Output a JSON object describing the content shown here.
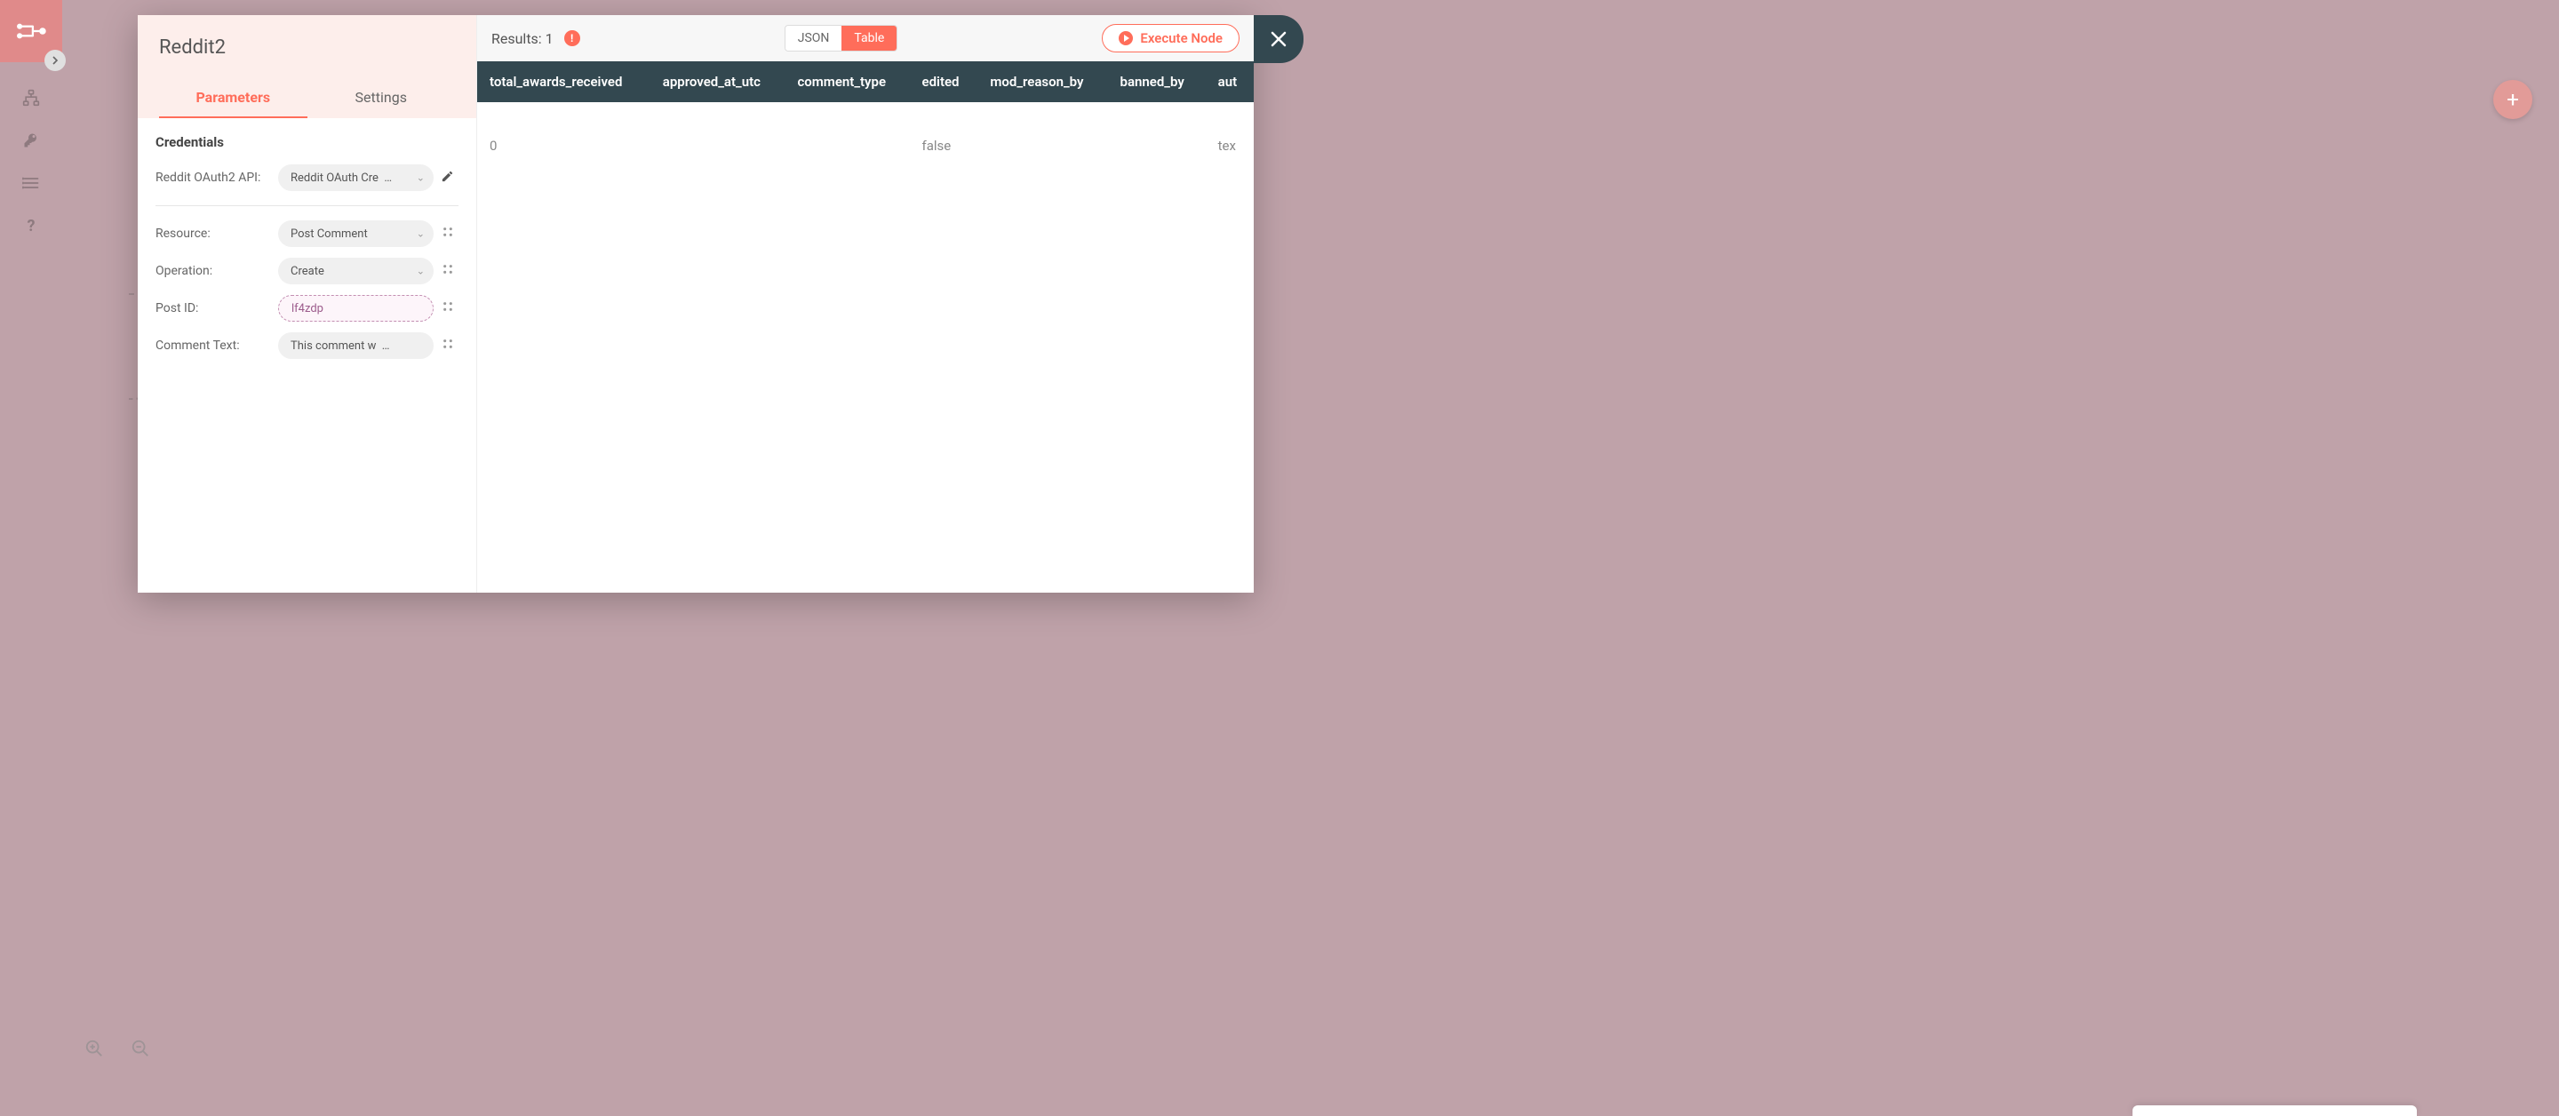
{
  "node_title": "Reddit2",
  "tabs": {
    "parameters": "Parameters",
    "settings": "Settings"
  },
  "credentials": {
    "heading": "Credentials",
    "api_label": "Reddit OAuth2 API:",
    "api_value": "Reddit OAuth Cre"
  },
  "params": {
    "resource_label": "Resource:",
    "resource_value": "Post Comment",
    "operation_label": "Operation:",
    "operation_value": "Create",
    "postid_label": "Post ID:",
    "postid_value": "lf4zdp",
    "comment_label": "Comment Text:",
    "comment_value": "This comment w"
  },
  "results": {
    "label": "Results: 1",
    "toggle_json": "JSON",
    "toggle_table": "Table",
    "execute_label": "Execute Node"
  },
  "table": {
    "headers": [
      "total_awards_received",
      "approved_at_utc",
      "comment_type",
      "edited",
      "mod_reason_by",
      "banned_by",
      "aut"
    ],
    "row0": {
      "c0": "0",
      "c1": "",
      "c2": "",
      "c3": "false",
      "c4": "",
      "c5": "",
      "c6": "tex"
    }
  }
}
